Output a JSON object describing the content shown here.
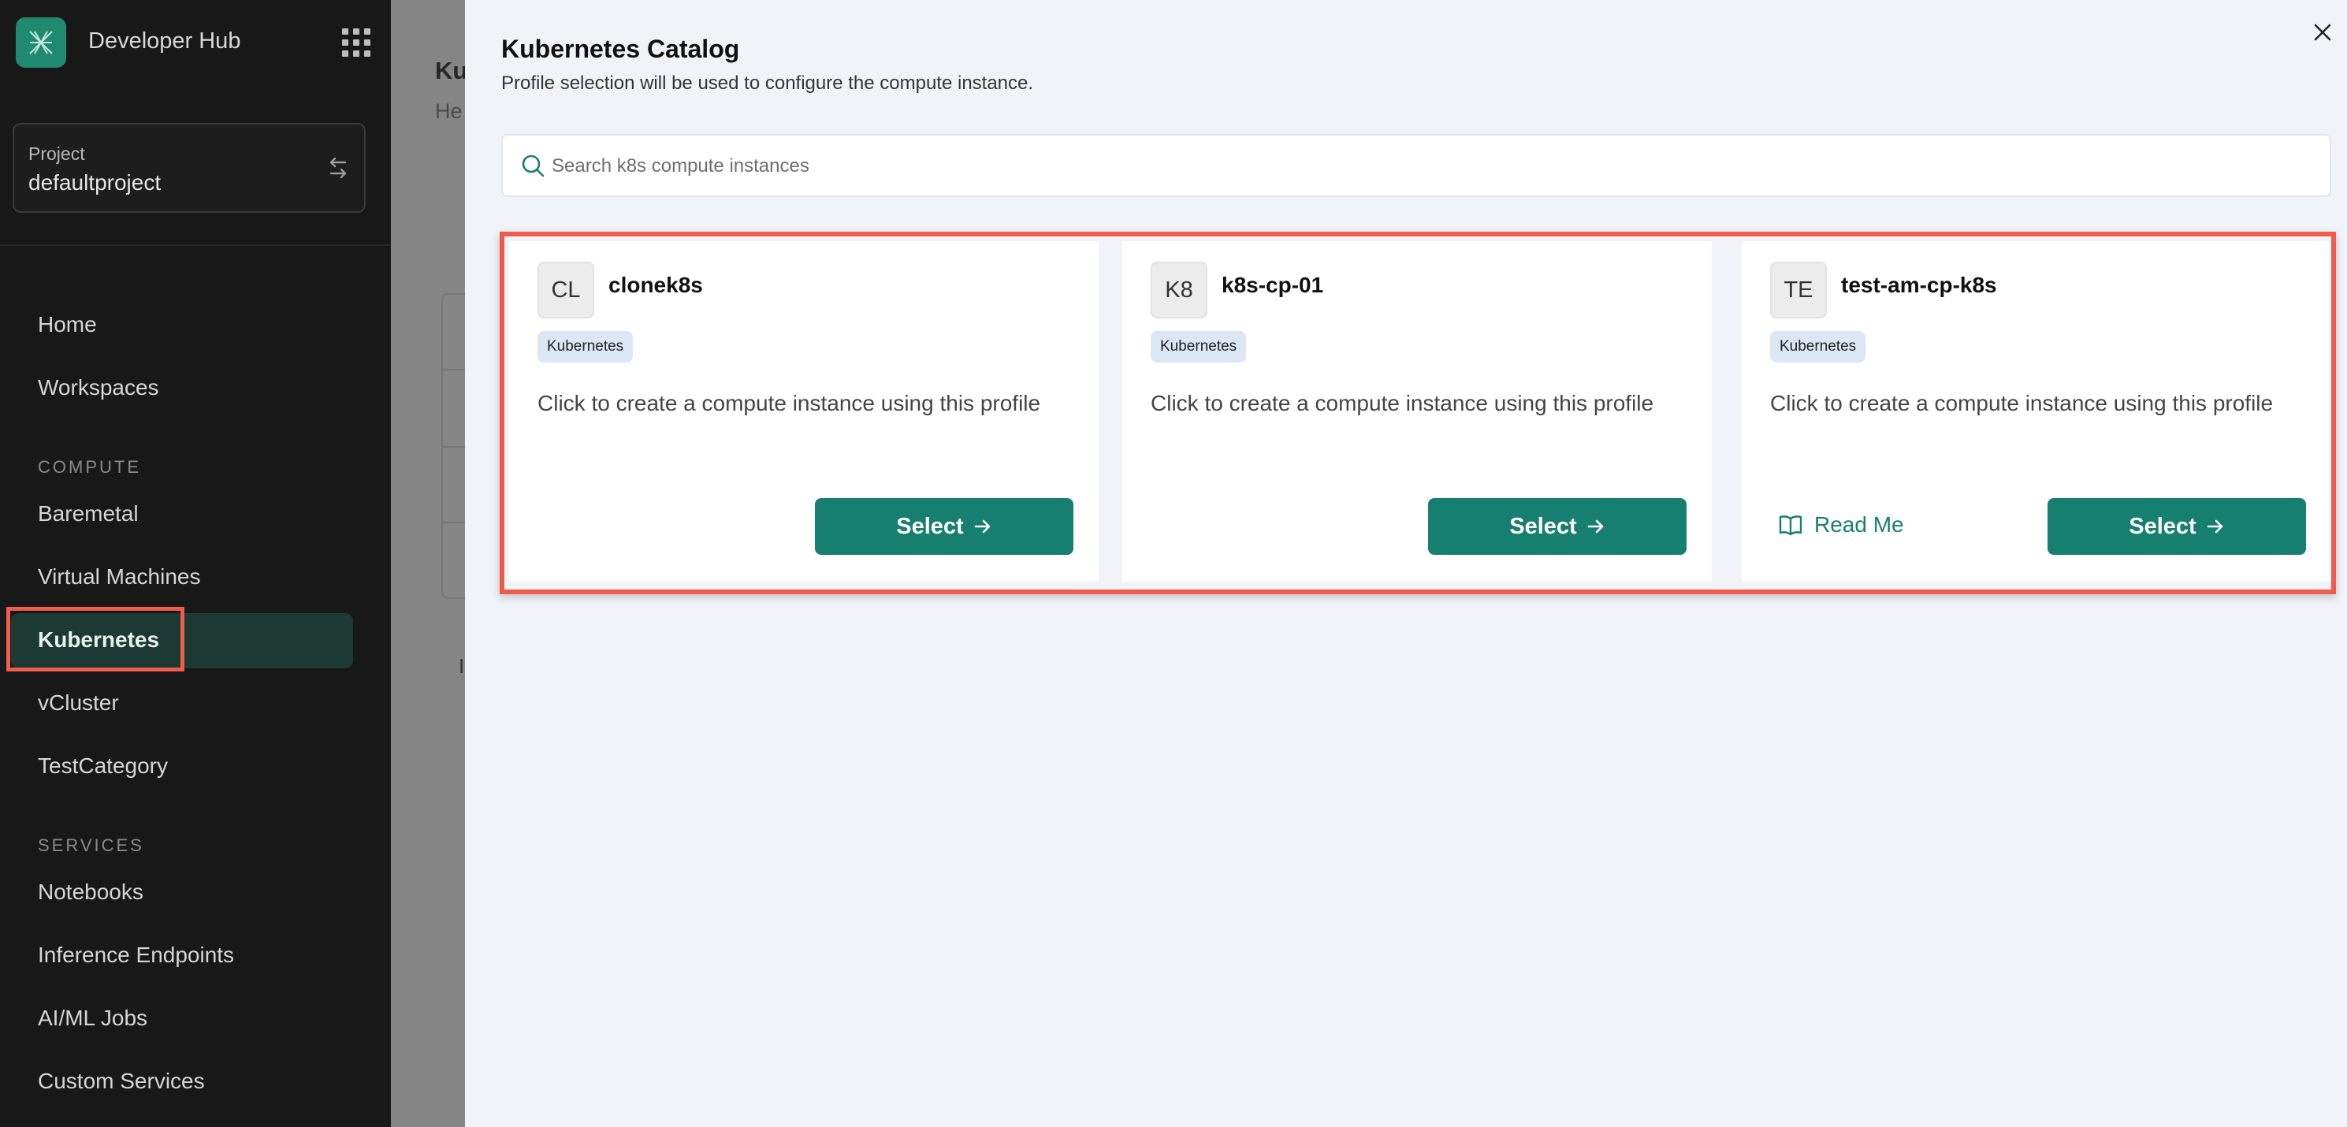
{
  "sidebar": {
    "app_title": "Developer Hub",
    "project": {
      "label": "Project",
      "value": "defaultproject"
    },
    "nav": {
      "home": "Home",
      "workspaces": "Workspaces",
      "compute_section": "COMPUTE",
      "baremetal": "Baremetal",
      "virtual_machines": "Virtual Machines",
      "kubernetes": "Kubernetes",
      "vcluster": "vCluster",
      "testcategory": "TestCategory",
      "services_section": "SERVICES",
      "notebooks": "Notebooks",
      "inference_endpoints": "Inference Endpoints",
      "aiml_jobs": "AI/ML Jobs",
      "custom_services": "Custom Services"
    },
    "active_item": "Kubernetes"
  },
  "background_page": {
    "title": "Ku",
    "subtitle": "He"
  },
  "drawer": {
    "title": "Kubernetes Catalog",
    "subtitle": "Profile selection will be used to configure the compute instance.",
    "search_placeholder": "Search k8s compute instances",
    "cards": [
      {
        "initials": "CL",
        "name": "clonek8s",
        "tag": "Kubernetes",
        "description": "Click to create a compute instance using this profile",
        "select_label": "Select"
      },
      {
        "initials": "K8",
        "name": "k8s-cp-01",
        "tag": "Kubernetes",
        "description": "Click to create a compute instance using this profile",
        "select_label": "Select"
      },
      {
        "initials": "TE",
        "name": "test-am-cp-k8s",
        "tag": "Kubernetes",
        "description": "Click to create a compute instance using this profile",
        "select_label": "Select",
        "readme_label": "Read Me"
      }
    ]
  },
  "colors": {
    "accent": "#167f6f",
    "highlight": "#ef5b4c",
    "sidebar_bg": "#181818",
    "active_nav_bg": "#1c3a33"
  }
}
